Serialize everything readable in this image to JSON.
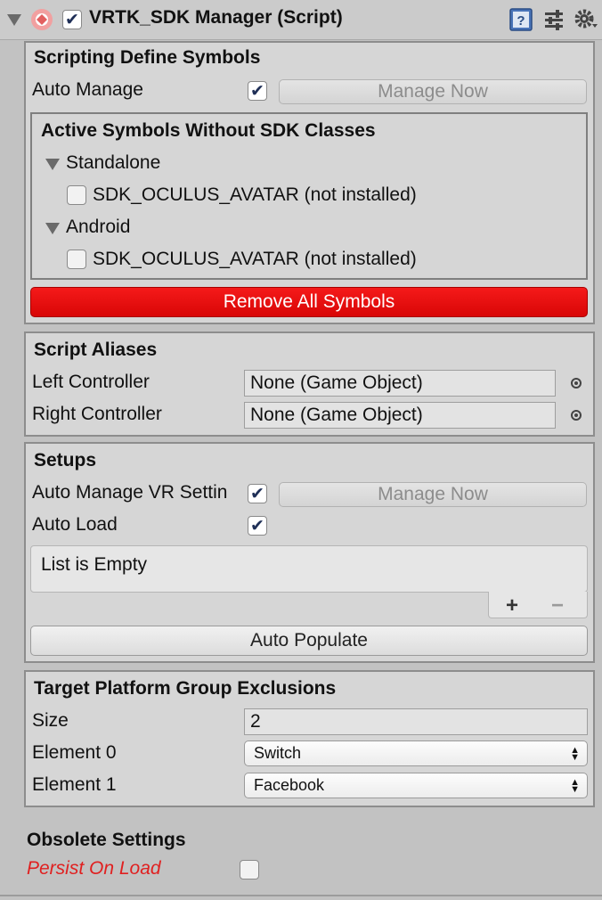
{
  "header": {
    "title": "VRTK_SDK Manager (Script)",
    "enabled": true,
    "icons": [
      "foldout-arrow-icon",
      "script-logo-icon",
      "help-book-icon",
      "preset-sliders-icon",
      "gear-icon"
    ]
  },
  "scripting": {
    "title": "Scripting Define Symbols",
    "auto_manage_label": "Auto Manage",
    "auto_manage_checked": true,
    "manage_now_label": "Manage Now",
    "active_title": "Active Symbols Without SDK Classes",
    "groups": [
      {
        "name": "Standalone",
        "symbol": "SDK_OCULUS_AVATAR (not installed)"
      },
      {
        "name": "Android",
        "symbol": "SDK_OCULUS_AVATAR (not installed)"
      }
    ],
    "remove_label": "Remove All Symbols"
  },
  "aliases": {
    "title": "Script Aliases",
    "left_label": "Left Controller",
    "left_value": "None (Game Object)",
    "right_label": "Right Controller",
    "right_value": "None (Game Object)"
  },
  "setups": {
    "title": "Setups",
    "auto_manage_vr_label": "Auto Manage VR Settin",
    "auto_manage_vr_checked": true,
    "manage_now_label": "Manage Now",
    "auto_load_label": "Auto Load",
    "auto_load_checked": true,
    "list_empty": "List is Empty",
    "plus": "+",
    "minus": "−",
    "auto_populate_label": "Auto Populate"
  },
  "exclusions": {
    "title": "Target Platform Group Exclusions",
    "size_label": "Size",
    "size_value": "2",
    "element0_label": "Element 0",
    "element0_value": "Switch",
    "element1_label": "Element 1",
    "element1_value": "Facebook"
  },
  "obsolete": {
    "title": "Obsolete Settings",
    "persist_label": "Persist On Load",
    "persist_color": "#e02020",
    "persist_checked": false
  }
}
